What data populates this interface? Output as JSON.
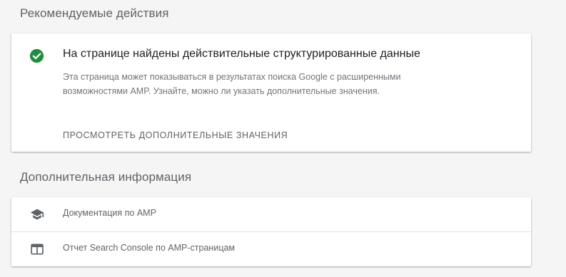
{
  "recommended": {
    "section_title": "Рекомендуемые действия",
    "result_title": "На странице найдены действительные структурированные данные",
    "description": "Эта страница может показываться в результатах поиска Google с расширенными возможностями AMP. Узнайте, можно ли указать дополнительные значения.",
    "action_label": "ПРОСМОТРЕТЬ ДОПОЛНИТЕЛЬНЫЕ ЗНАЧЕНИЯ",
    "status_icon": "check-circle-icon",
    "status_color": "#1e8e3e"
  },
  "additional": {
    "section_title": "Дополнительная информация",
    "items": [
      {
        "label": "Документация по AMP",
        "icon": "school-icon"
      },
      {
        "label": "Отчет Search Console по AMP-страницам",
        "icon": "web-report-icon"
      }
    ]
  },
  "colors": {
    "background": "#f5f5f5",
    "card": "#ffffff",
    "icon": "#5f6368"
  }
}
